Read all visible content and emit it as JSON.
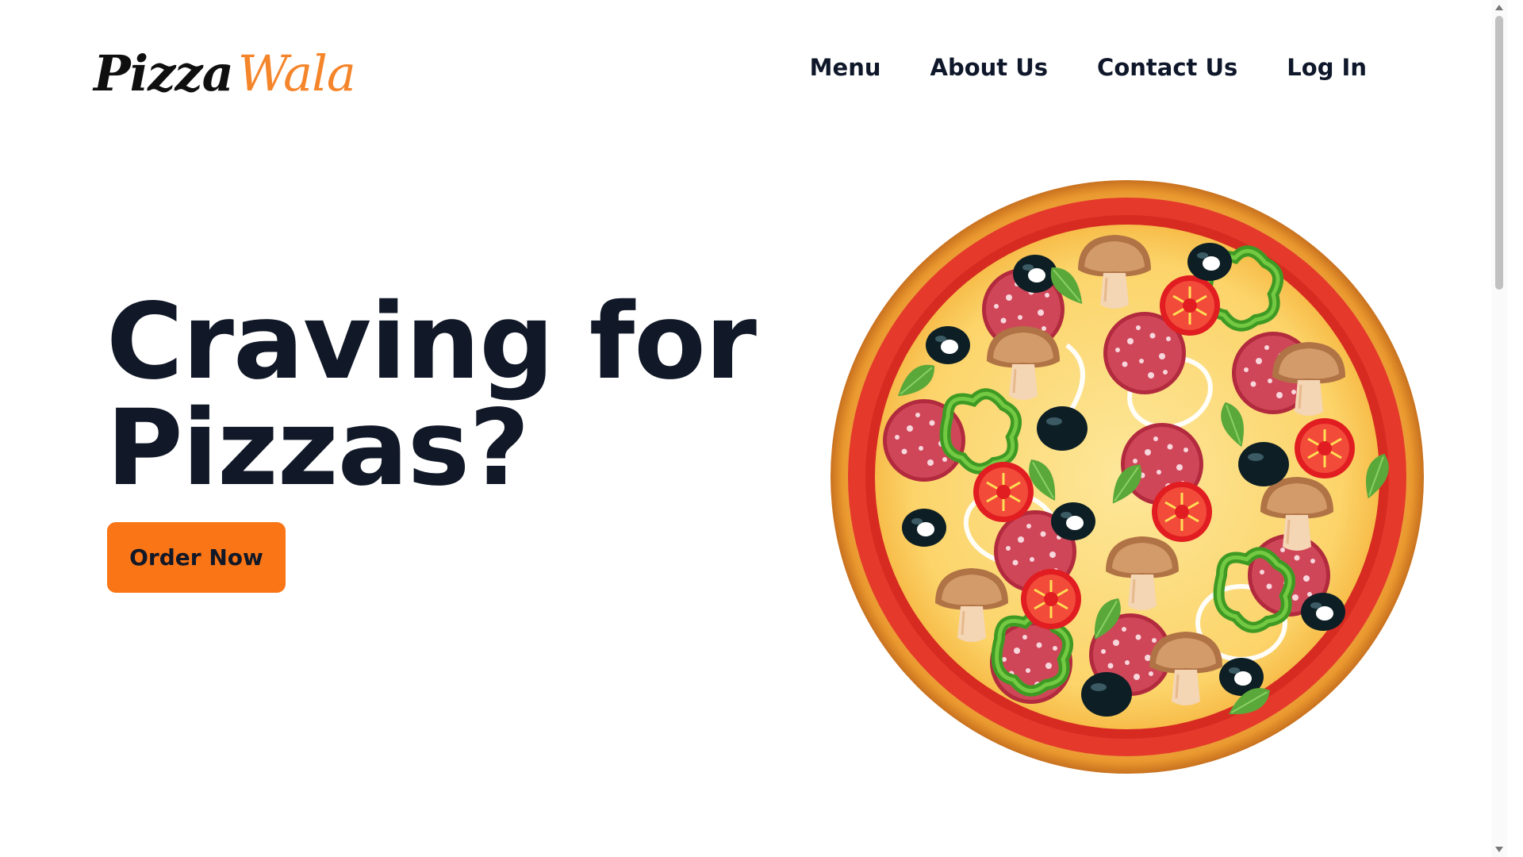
{
  "header": {
    "logo": {
      "part1": "Pizza",
      "part2": "Wala"
    },
    "nav": [
      {
        "label": "Menu"
      },
      {
        "label": "About Us"
      },
      {
        "label": "Contact Us"
      },
      {
        "label": "Log In"
      }
    ]
  },
  "hero": {
    "headline_line1": "Craving for",
    "headline_line2": "Pizzas?",
    "cta_label": "Order Now",
    "image_icon": "pizza-illustration"
  },
  "colors": {
    "accent": "#f97516",
    "logo_accent": "#f5852a",
    "text_dark": "#111827"
  }
}
